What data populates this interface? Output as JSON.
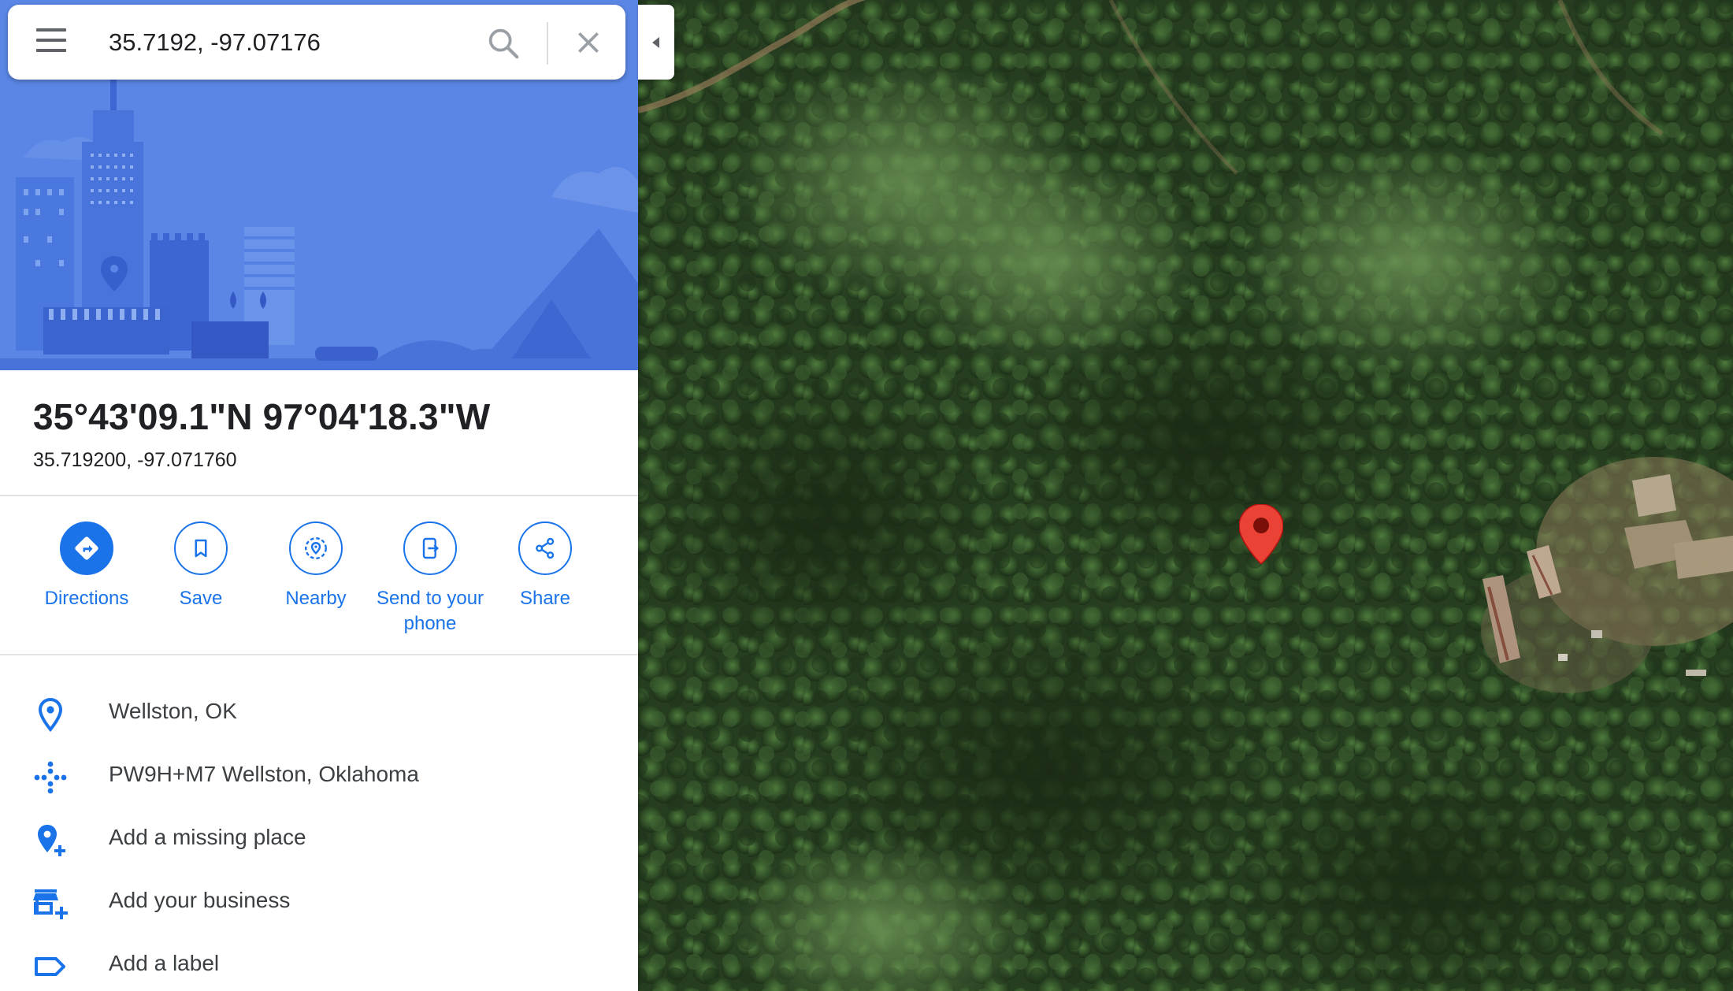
{
  "search": {
    "value": "35.7192, -97.07176"
  },
  "place": {
    "title": "35°43'09.1\"N 97°04'18.3\"W",
    "subtitle": "35.719200, -97.071760"
  },
  "actions": [
    {
      "label": "Directions",
      "icon": "directions-icon"
    },
    {
      "label": "Save",
      "icon": "bookmark-icon"
    },
    {
      "label": "Nearby",
      "icon": "nearby-icon"
    },
    {
      "label": "Send to your phone",
      "icon": "send-to-phone-icon"
    },
    {
      "label": "Share",
      "icon": "share-icon"
    }
  ],
  "info": [
    {
      "text": "Wellston, OK",
      "icon": "location-pin-icon"
    },
    {
      "text": "PW9H+M7 Wellston, Oklahoma",
      "icon": "plus-code-icon"
    },
    {
      "text": "Add a missing place",
      "icon": "add-place-icon"
    },
    {
      "text": "Add your business",
      "icon": "add-business-icon"
    },
    {
      "text": "Add a label",
      "icon": "label-icon"
    }
  ],
  "colors": {
    "accent": "#1a73e8",
    "hero": "#5b86e5",
    "pin": "#ea4335",
    "foliage": "#2f4a27"
  }
}
